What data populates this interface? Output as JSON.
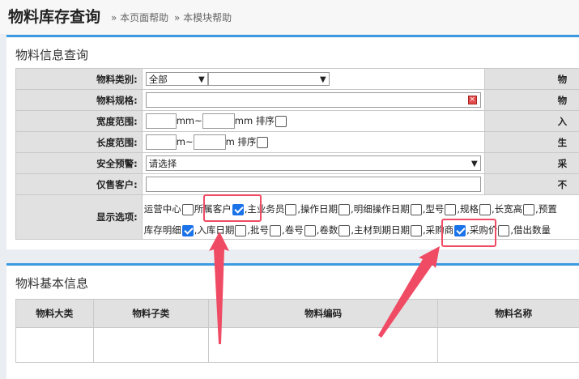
{
  "header": {
    "title": "物料库存查询",
    "help_page": "» 本页面帮助",
    "help_module": "» 本模块帮助"
  },
  "query": {
    "title": "物料信息查询",
    "material_category": {
      "label": "物料类别:",
      "value": "全部",
      "sub_value": ""
    },
    "material_spec": {
      "label": "物料规格:",
      "value": ""
    },
    "width_range": {
      "label": "宽度范围:",
      "unit": "mm",
      "sep": "~",
      "sort_label": "mm 排序"
    },
    "length_range": {
      "label": "长度范围:",
      "unit": "m",
      "sep": "~",
      "sort_label": "m 排序"
    },
    "safety_alert": {
      "label": "安全预警:",
      "value": "请选择"
    },
    "exclusive_customer": {
      "label": "仅售客户:",
      "value": ""
    },
    "display_options": {
      "label": "显示选项:",
      "row1": [
        {
          "label": "运营中心",
          "checked": false
        },
        {
          "label": "所属客户",
          "checked": true
        },
        {
          "label": ",主业务员",
          "checked": false
        },
        {
          "label": ",操作日期",
          "checked": false
        },
        {
          "label": ",明细操作日期",
          "checked": false
        },
        {
          "label": ",型号",
          "checked": false
        },
        {
          "label": ",规格",
          "checked": false
        },
        {
          "label": ",长宽高",
          "checked": false
        },
        {
          "label": ",预置",
          "checked": false
        }
      ],
      "row2": [
        {
          "label": "库存明细",
          "checked": true
        },
        {
          "label": ",入库日期",
          "checked": false
        },
        {
          "label": ",批号",
          "checked": false
        },
        {
          "label": ",卷号",
          "checked": false
        },
        {
          "label": ",卷数",
          "checked": false
        },
        {
          "label": ",主材到期日期",
          "checked": false
        },
        {
          "label": ",采购商",
          "checked": true
        },
        {
          "label": ",采购价",
          "checked": false
        },
        {
          "label": ",借出数量",
          "checked": false
        }
      ]
    },
    "right_labels": [
      "物",
      "物",
      "入",
      "生",
      "采",
      "不"
    ]
  },
  "basic_info": {
    "title": "物料基本信息",
    "columns": [
      "物料大类",
      "物料子类",
      "物料编码",
      "物料名称"
    ]
  },
  "colors": {
    "accent": "#3b9ae1",
    "highlight": "#f04b64",
    "checkbox": "#1a73e8"
  }
}
